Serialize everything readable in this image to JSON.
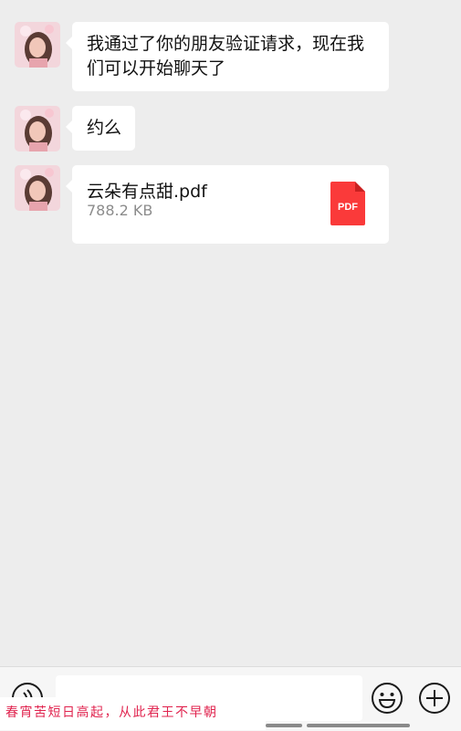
{
  "messages": [
    {
      "type": "text",
      "text": "我通过了你的朋友验证请求，现在我们可以开始聊天了"
    },
    {
      "type": "text",
      "text": "约么"
    },
    {
      "type": "file",
      "file_name": "云朵有点甜.pdf",
      "file_size": "788.2 KB",
      "file_type": "PDF"
    }
  ],
  "input": {
    "placeholder": ""
  },
  "icons": {
    "voice": "voice-icon",
    "emoji": "emoji-icon",
    "plus": "plus-icon",
    "file": "pdf-file-icon"
  },
  "watermark": "春宵苦短日高起，从此君王不早朝",
  "colors": {
    "background": "#ededed",
    "bubble": "#ffffff",
    "pdf": "#fa3a3a",
    "watermark": "#e0234e"
  }
}
